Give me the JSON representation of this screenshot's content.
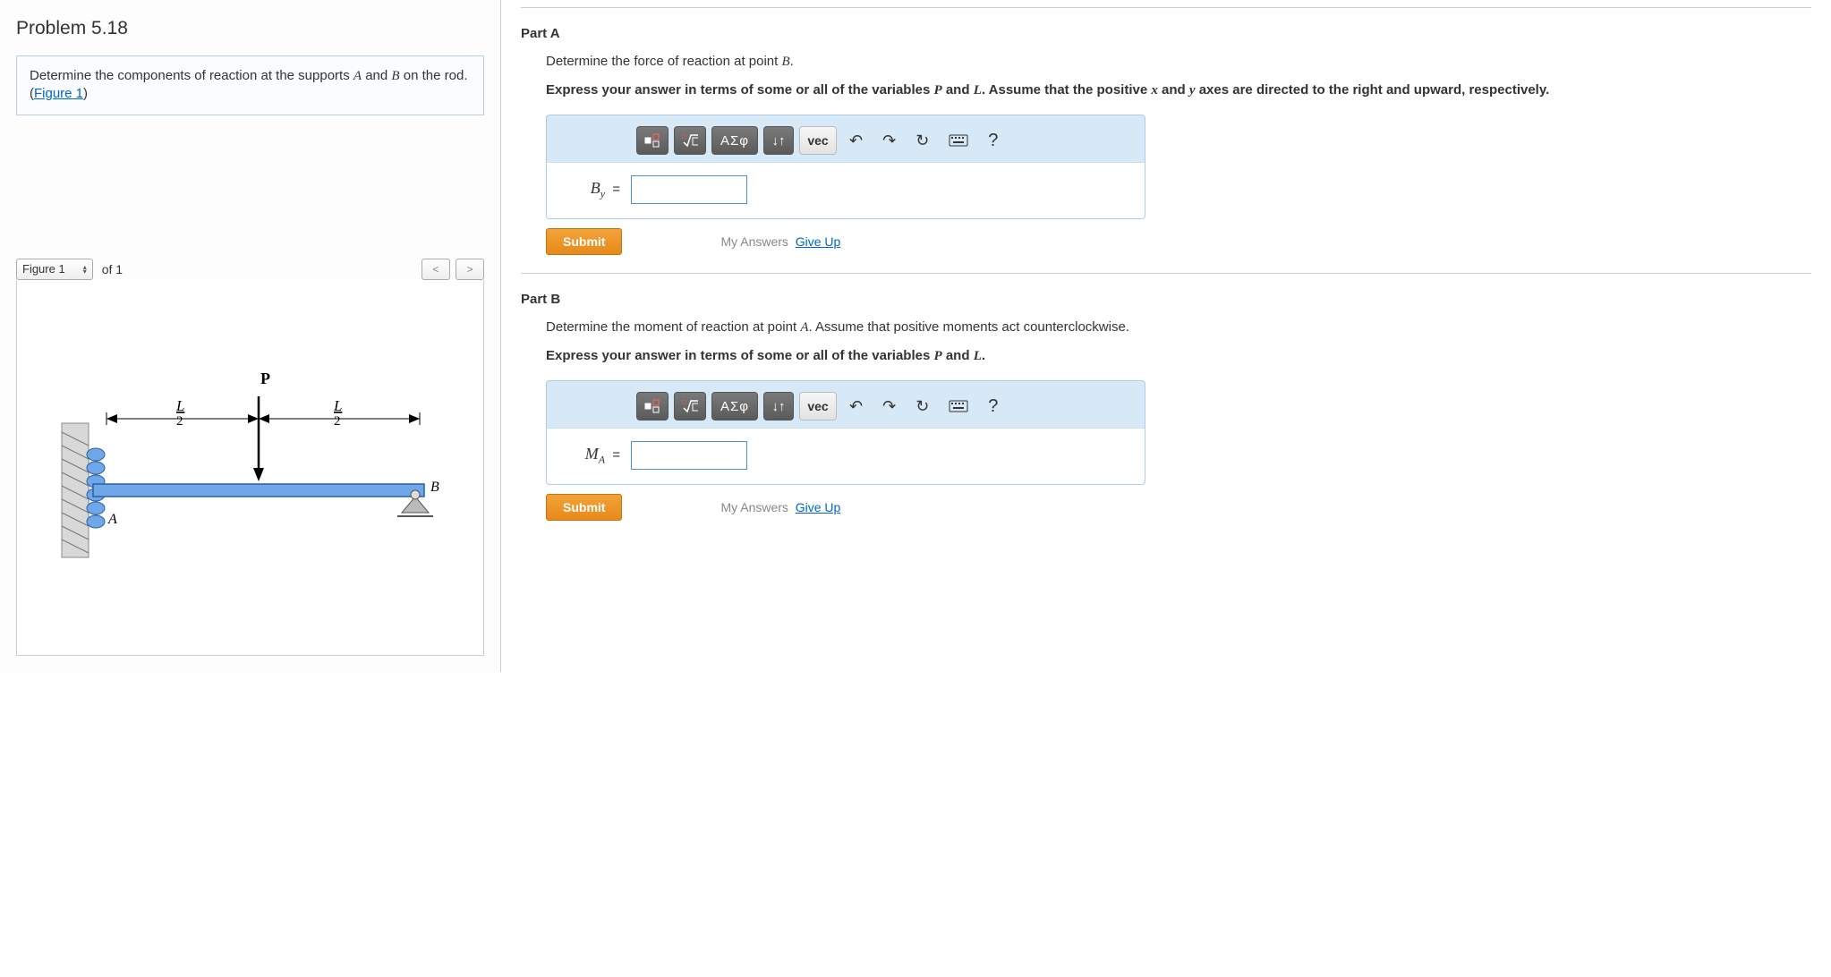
{
  "problem": {
    "title": "Problem 5.18",
    "statement_pre": "Determine the components of reaction at the supports ",
    "var_A": "A",
    "statement_mid": " and ",
    "var_B": "B",
    "statement_post": " on the rod. (",
    "figure_link": "Figure 1",
    "statement_close": ")"
  },
  "figure": {
    "selector_label": "Figure 1",
    "of_label": "of 1",
    "label_P": "P",
    "label_L2a": "L",
    "label_L2a_den": "2",
    "label_L2b": "L",
    "label_L2b_den": "2",
    "label_A": "A",
    "label_B": "B"
  },
  "partA": {
    "heading": "Part A",
    "prompt_pre": "Determine the force of reaction at point ",
    "prompt_var": "B",
    "prompt_post": ".",
    "instr_pre": "Express your answer in terms of some or all of the variables ",
    "var_P": "P",
    "instr_and": " and ",
    "var_L": "L",
    "instr_post": ". Assume that the positive ",
    "var_x": "x",
    "instr_and2": " and ",
    "var_y": "y",
    "instr_tail": " axes are directed to the right and upward, respectively.",
    "toolbar": {
      "greek": "ΑΣφ",
      "vec": "vec",
      "help": "?"
    },
    "answer_label": "B",
    "answer_sub": "y",
    "answer_eq": " =",
    "submit": "Submit",
    "my_answers": "My Answers",
    "give_up": "Give Up"
  },
  "partB": {
    "heading": "Part B",
    "prompt_pre": "Determine the moment of reaction at point ",
    "prompt_var": "A",
    "prompt_post": ". Assume that positive moments act counterclockwise.",
    "instr_pre": "Express your answer in terms of some or all of the variables ",
    "var_P": "P",
    "instr_and": " and ",
    "var_L": "L",
    "instr_post": ".",
    "toolbar": {
      "greek": "ΑΣφ",
      "vec": "vec",
      "help": "?"
    },
    "answer_label": "M",
    "answer_sub": "A",
    "answer_eq": " =",
    "submit": "Submit",
    "my_answers": "My Answers",
    "give_up": "Give Up"
  }
}
